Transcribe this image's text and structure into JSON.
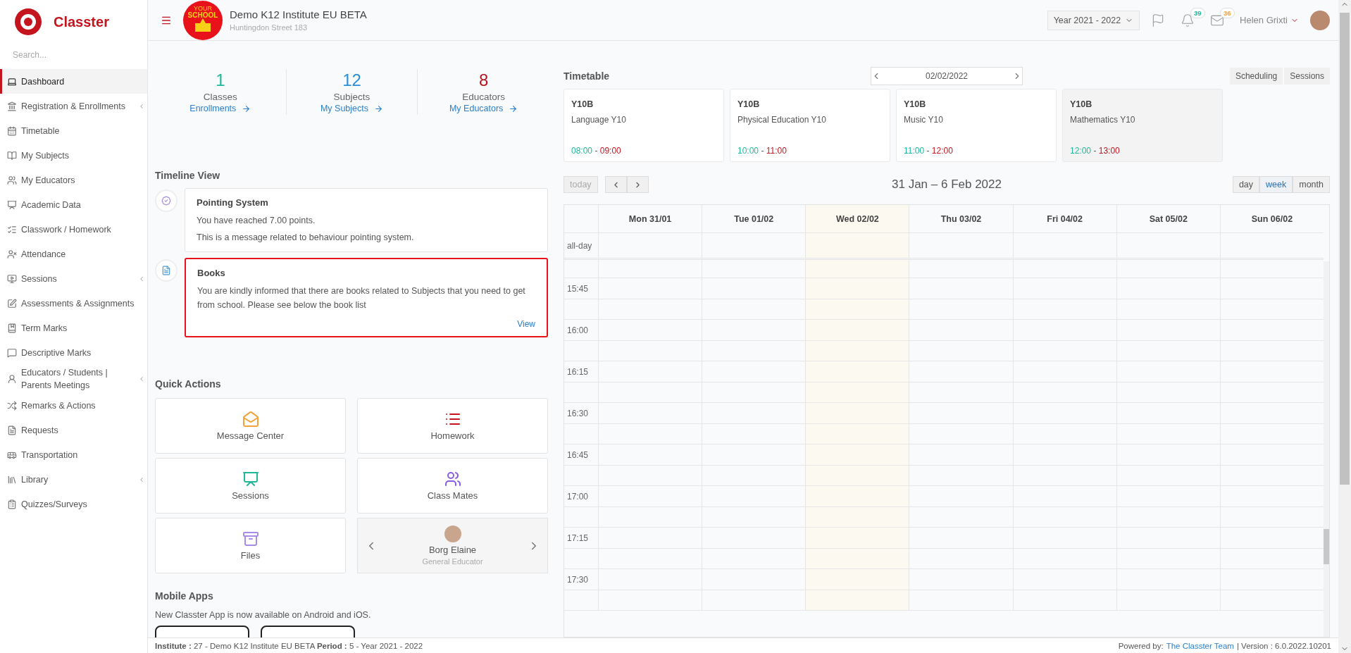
{
  "sidebar": {
    "brand": "Classter",
    "search_placeholder": "Search...",
    "items": [
      {
        "label": "Dashboard",
        "selected": true,
        "expandable": false
      },
      {
        "label": "Registration & Enrollments",
        "selected": false,
        "expandable": true
      },
      {
        "label": "Timetable",
        "selected": false,
        "expandable": false
      },
      {
        "label": "My Subjects",
        "selected": false,
        "expandable": false
      },
      {
        "label": "My Educators",
        "selected": false,
        "expandable": false
      },
      {
        "label": "Academic Data",
        "selected": false,
        "expandable": false
      },
      {
        "label": "Classwork / Homework",
        "selected": false,
        "expandable": false
      },
      {
        "label": "Attendance",
        "selected": false,
        "expandable": false
      },
      {
        "label": "Sessions",
        "selected": false,
        "expandable": true
      },
      {
        "label": "Assessments & Assignments",
        "selected": false,
        "expandable": false
      },
      {
        "label": "Term Marks",
        "selected": false,
        "expandable": false
      },
      {
        "label": "Descriptive Marks",
        "selected": false,
        "expandable": false
      },
      {
        "label": "Educators / Students | Parents Meetings",
        "selected": false,
        "expandable": true
      },
      {
        "label": "Remarks & Actions",
        "selected": false,
        "expandable": false
      },
      {
        "label": "Requests",
        "selected": false,
        "expandable": false
      },
      {
        "label": "Transportation",
        "selected": false,
        "expandable": false
      },
      {
        "label": "Library",
        "selected": false,
        "expandable": true
      },
      {
        "label": "Quizzes/Surveys",
        "selected": false,
        "expandable": false
      }
    ]
  },
  "header": {
    "school_logo": {
      "top": "YOUR",
      "bottom": "SCHOOL"
    },
    "school_name": "Demo K12 Institute EU BETA",
    "address": "Huntingdon Street 183",
    "year": "Year 2021 - 2022",
    "notifications": "39",
    "messages": "36",
    "user": "Helen Grixti"
  },
  "stats": [
    {
      "value": "1",
      "label": "Classes",
      "link": "Enrollments",
      "color": "#1fb89a"
    },
    {
      "value": "12",
      "label": "Subjects",
      "link": "My Subjects",
      "color": "#2a8fd6"
    },
    {
      "value": "8",
      "label": "Educators",
      "link": "My Educators",
      "color": "#b5121b"
    }
  ],
  "timeline": {
    "title": "Timeline View",
    "entries": [
      {
        "kind": "points",
        "title": "Pointing System",
        "lines": [
          "You have reached 7.00 points.",
          "This is a message related to behaviour pointing system."
        ],
        "highlighted": false
      },
      {
        "kind": "document",
        "title": "Books",
        "lines": [
          "You are kindly informed that there are books related to Subjects that you need to get from school. Please see below the book list"
        ],
        "link": "View",
        "highlighted": true
      }
    ]
  },
  "quick_actions": {
    "title": "Quick Actions",
    "actions": [
      {
        "kind": "message",
        "label": "Message Center"
      },
      {
        "kind": "homework",
        "label": "Homework"
      },
      {
        "kind": "sessions",
        "label": "Sessions"
      },
      {
        "kind": "classmates",
        "label": "Class Mates"
      },
      {
        "kind": "files",
        "label": "Files"
      }
    ],
    "educator": {
      "name": "Borg Elaine",
      "role": "General Educator"
    }
  },
  "mobile_apps": {
    "title": "Mobile Apps",
    "text": "New Classter App is now available on Android and iOS."
  },
  "timetable": {
    "title": "Timetable",
    "date": "02/02/2022",
    "buttons": [
      "Scheduling",
      "Sessions"
    ],
    "lessons": [
      {
        "class": "Y10B",
        "subject": "Language Y10",
        "start": "08:00",
        "separator": "-",
        "end": "09:00",
        "current": false
      },
      {
        "class": "Y10B",
        "subject": "Physical Education Y10",
        "start": "10:00",
        "separator": "-",
        "end": "11:00",
        "current": false
      },
      {
        "class": "Y10B",
        "subject": "Music Y10",
        "start": "11:00",
        "separator": "-",
        "end": "12:00",
        "current": false
      },
      {
        "class": "Y10B",
        "subject": "Mathematics Y10",
        "start": "12:00",
        "separator": "-",
        "end": "13:00",
        "current": true
      }
    ]
  },
  "calendar": {
    "today_button": "today",
    "title": "31 Jan – 6 Feb 2022",
    "views": [
      {
        "label": "day",
        "selected": false
      },
      {
        "label": "week",
        "selected": true
      },
      {
        "label": "month",
        "selected": false
      }
    ],
    "days": [
      {
        "label": "Mon 31/01",
        "today": false
      },
      {
        "label": "Tue 01/02",
        "today": false
      },
      {
        "label": "Wed 02/02",
        "today": true
      },
      {
        "label": "Thu 03/02",
        "today": false
      },
      {
        "label": "Fri 04/02",
        "today": false
      },
      {
        "label": "Sat 05/02",
        "today": false
      },
      {
        "label": "Sun 06/02",
        "today": false
      }
    ],
    "all_day_label": "all-day",
    "times": [
      "15:45",
      "16:00",
      "16:15",
      "16:30",
      "16:45",
      "17:00",
      "17:15",
      "17:30"
    ]
  },
  "footer": {
    "info": "**Institute :** 27 - Demo K12 Institute EU BETA **Period :** 5 - Year 2021 - 2022",
    "powered_by": "Powered by:",
    "team_link": "The Classter Team",
    "version": "| Version : 6.0.2022.10201"
  }
}
